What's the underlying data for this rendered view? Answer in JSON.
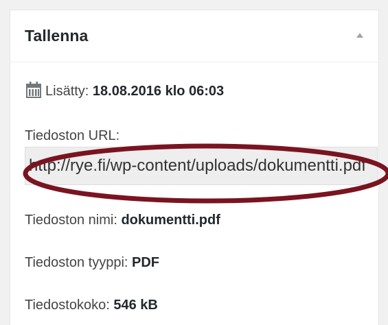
{
  "box": {
    "title": "Tallenna",
    "toggle_icon": "triangle-up-icon"
  },
  "added": {
    "icon": "calendar-icon",
    "label": "Lisätty:",
    "value": "18.08.2016 klo 06:03"
  },
  "file_url": {
    "label": "Tiedoston URL:",
    "value": "http://rye.fi/wp-content/uploads/dokumentti.pdf"
  },
  "file_name": {
    "label": "Tiedoston nimi:",
    "value": "dokumentti.pdf"
  },
  "file_type": {
    "label": "Tiedoston tyyppi:",
    "value": "PDF"
  },
  "file_size": {
    "label": "Tiedostokoko:",
    "value": "546 kB"
  },
  "colors": {
    "highlight": "#7a1420",
    "text": "#444444",
    "value_text": "#23282d",
    "field_background": "#eeeeee"
  }
}
